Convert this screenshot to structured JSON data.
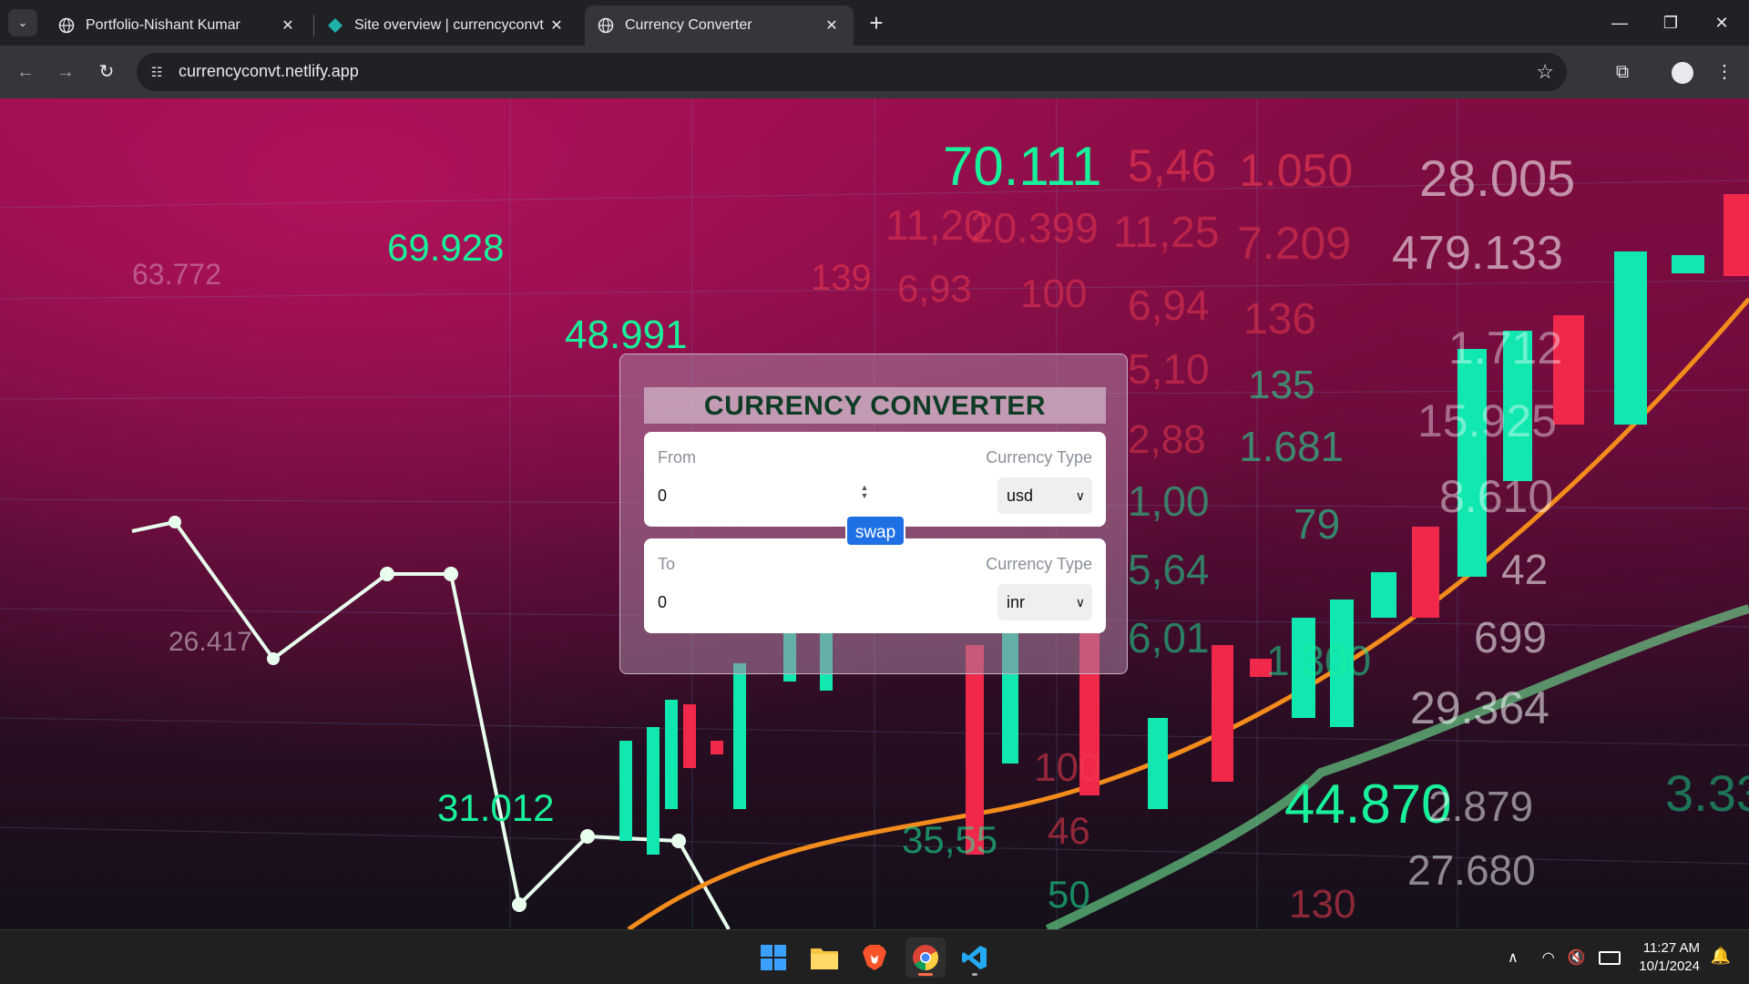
{
  "browser": {
    "tabs": [
      {
        "title": "Portfolio-Nishant Kumar",
        "active": false
      },
      {
        "title": "Site overview | currencyconvt | Netlify",
        "active": false
      },
      {
        "title": "Currency Converter",
        "active": true
      }
    ],
    "url": "currencyconvt.netlify.app"
  },
  "converter": {
    "title": "CURRENCY CONVERTER",
    "from": {
      "label": "From",
      "currency_label": "Currency Type",
      "amount": "0",
      "currency": "usd"
    },
    "to": {
      "label": "To",
      "currency_label": "Currency Type",
      "amount": "0",
      "currency": "inr"
    },
    "swap_label": "swap"
  },
  "background_numbers": [
    "70.111",
    "5,46",
    "1.050",
    "28.005",
    "69.928",
    "63.772",
    "11,20",
    "20.399",
    "11,25",
    "7.209",
    "479.133",
    "48.991",
    "139",
    "6,93",
    "100",
    "6,94",
    "136",
    "1.712",
    "5,10",
    "135",
    "15.925",
    "2,88",
    "1.681",
    "8.610",
    "1,00",
    "79",
    "42",
    "5,64",
    "699",
    "6,01",
    "1.300",
    "29.364",
    "26.417",
    "31.012",
    "44.870",
    "2.879",
    "27.680",
    "35,55",
    "46",
    "50",
    "130",
    "3.33",
    "100"
  ],
  "taskbar": {
    "time": "11:27 AM",
    "date": "10/1/2024"
  },
  "colors": {
    "accent_button": "#1f6fe5",
    "title_text": "#0d3b24",
    "candle_up": "#10e8b0",
    "candle_down": "#f0284a",
    "trend_line": "#f28c1c"
  }
}
